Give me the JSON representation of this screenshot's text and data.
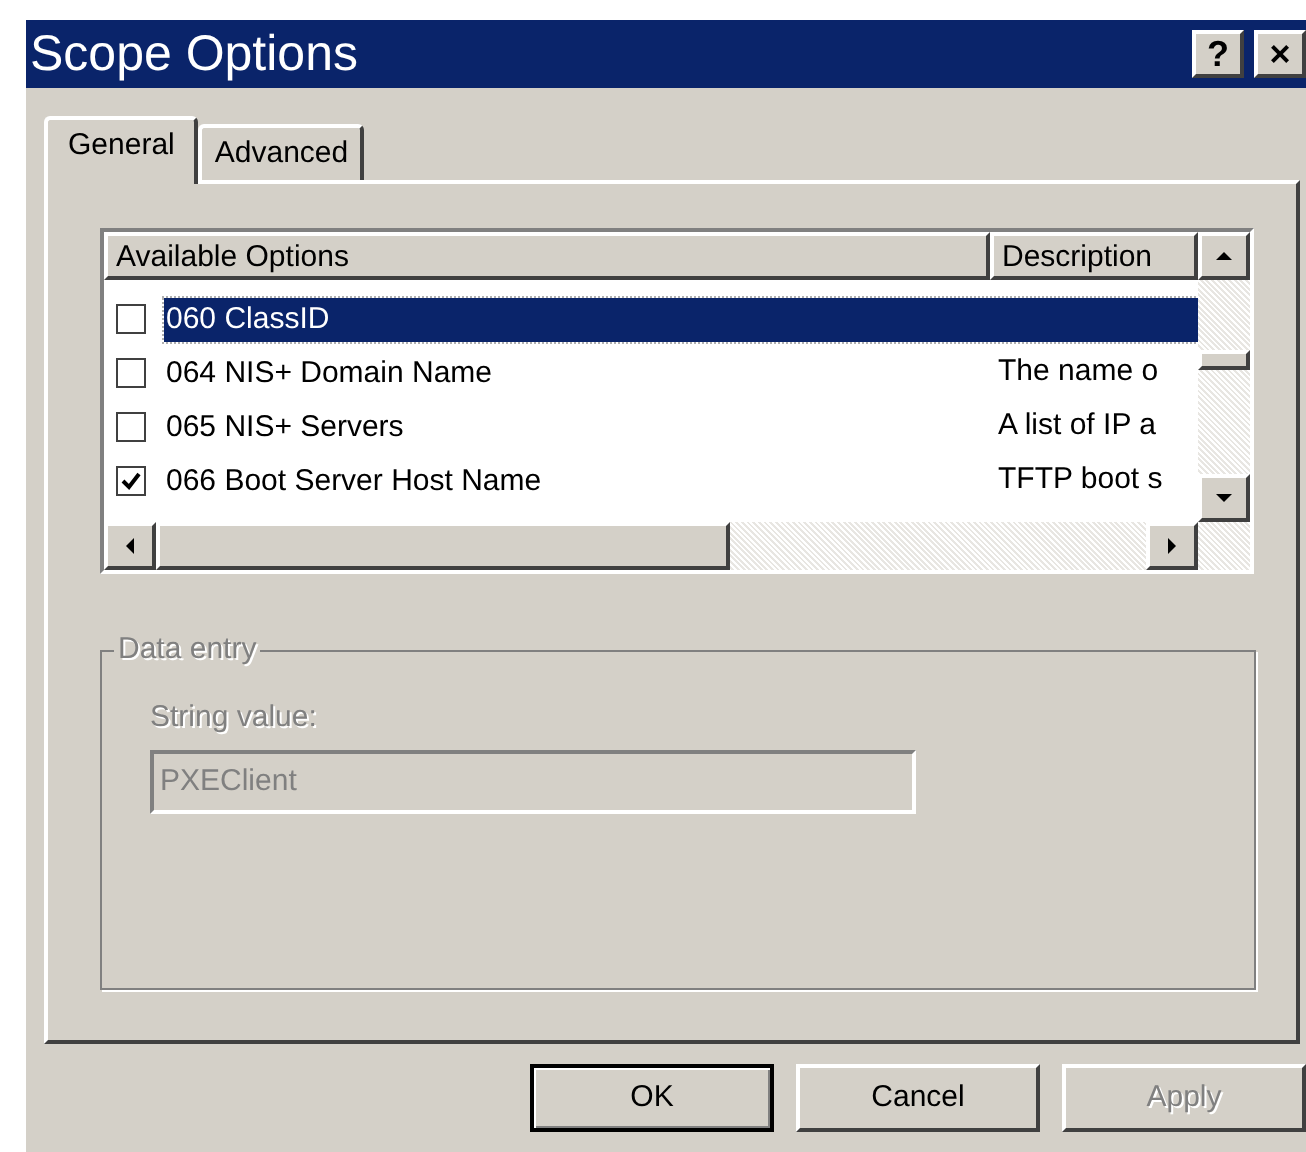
{
  "window": {
    "title": "Scope Options",
    "title_buttons": [
      "?",
      "×"
    ]
  },
  "tabs": [
    {
      "label": "General",
      "selected": true
    },
    {
      "label": "Advanced",
      "selected": false
    }
  ],
  "options_list": {
    "columns": [
      "Available Options",
      "Description"
    ],
    "rows": [
      {
        "option": "060 ClassID",
        "checked": false,
        "selected": true
      },
      {
        "option": "064 NIS+ Domain Name",
        "description": "The name o",
        "checked": false,
        "selected": false
      },
      {
        "option": "065 NIS+ Servers",
        "description": "A list of IP a",
        "checked": false,
        "selected": false
      },
      {
        "option": "066 Boot Server Host Name",
        "description": "TFTP boot s",
        "checked": true,
        "selected": false
      }
    ]
  },
  "data_entry": {
    "title": "Data entry",
    "disabled": true,
    "field_label": "String value:",
    "value": "PXEClient"
  },
  "buttons": [
    {
      "label": "OK",
      "default": true,
      "disabled": false
    },
    {
      "label": "Cancel",
      "default": false,
      "disabled": false
    },
    {
      "label": "Apply",
      "default": false,
      "disabled": true
    }
  ]
}
